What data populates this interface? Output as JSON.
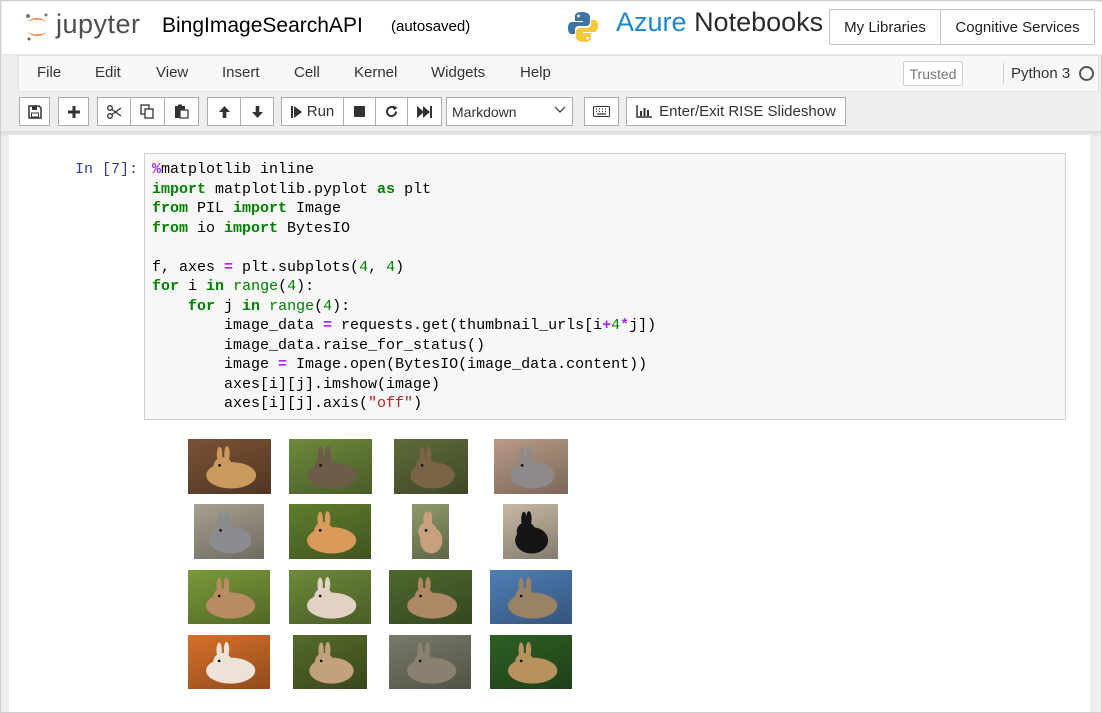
{
  "header": {
    "logo_text": "jupyter",
    "notebook_name": "BingImageSearchAPI",
    "save_status": "(autosaved)",
    "brand_word1": "Azure",
    "brand_word2": "Notebooks",
    "my_libraries": "My Libraries",
    "cognitive_services": "Cognitive Services"
  },
  "menu": {
    "items": [
      "File",
      "Edit",
      "View",
      "Insert",
      "Cell",
      "Kernel",
      "Widgets",
      "Help"
    ],
    "trusted": "Trusted",
    "kernel_name": "Python 3"
  },
  "toolbar": {
    "run_label": "Run",
    "cell_type": "Markdown",
    "rise_label": "Enter/Exit RISE Slideshow"
  },
  "cell": {
    "prompt": "In [7]:",
    "code": [
      "%matplotlib inline",
      "import matplotlib.pyplot as plt",
      "from PIL import Image",
      "from io import BytesIO",
      "",
      "f, axes = plt.subplots(4, 4)",
      "for i in range(4):",
      "    for j in range(4):",
      "        image_data = requests.get(thumbnail_urls[i+4*j])",
      "        image_data.raise_for_status()",
      "        image = Image.open(BytesIO(image_data.content))",
      "        axes[i][j].imshow(image)",
      "        axes[i][j].axis(\"off\")"
    ]
  },
  "output": {
    "thumbnails": [
      {
        "bg": "#7a5236",
        "fg": "#c9995e"
      },
      {
        "bg": "#6e8a3c",
        "fg": "#6d5c48"
      },
      {
        "bg": "#5f6b3a",
        "fg": "#7a6445"
      },
      {
        "bg": "#b99a86",
        "fg": "#8f8a8a"
      },
      {
        "bg": "#a7a08f",
        "fg": "#8a8c92"
      },
      {
        "bg": "#5f7e2e",
        "fg": "#d99a5a"
      },
      {
        "bg": "#8e9a6a",
        "fg": "#c8a07e"
      },
      {
        "bg": "#c7b8a4",
        "fg": "#151515"
      },
      {
        "bg": "#7a9a3a",
        "fg": "#b88c62"
      },
      {
        "bg": "#6e8a3a",
        "fg": "#e2d2c4"
      },
      {
        "bg": "#4e6a2e",
        "fg": "#ae8866"
      },
      {
        "bg": "#4f7fb8",
        "fg": "#9a8266"
      },
      {
        "bg": "#d8702a",
        "fg": "#ece2d8"
      },
      {
        "bg": "#556b2a",
        "fg": "#c2a27c"
      },
      {
        "bg": "#7a7a6a",
        "fg": "#8a8070"
      },
      {
        "bg": "#2f5f24",
        "fg": "#b8925e"
      }
    ]
  }
}
